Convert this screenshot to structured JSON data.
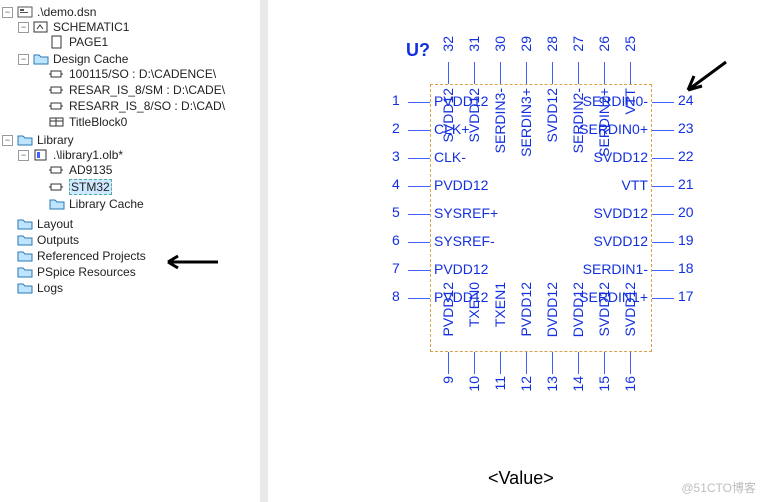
{
  "tree": {
    "root": ".\\demo.dsn",
    "schematic": "SCHEMATIC1",
    "page": "PAGE1",
    "cache": "Design Cache",
    "cache_items": [
      "100115/SO : D:\\CADENCE\\",
      "RESAR_IS_8/SM : D:\\CADE\\",
      "RESARR_IS_8/SO : D:\\CAD\\",
      "TitleBlock0"
    ],
    "library": "Library",
    "lib_file": ".\\library1.olb*",
    "parts": [
      "AD9135",
      "STM32"
    ],
    "lib_cache": "Library Cache",
    "folders": [
      "Layout",
      "Outputs",
      "Referenced Projects",
      "PSpice Resources",
      "Logs"
    ]
  },
  "schematic": {
    "refdes": "U?",
    "value": "<Value>",
    "left": [
      {
        "n": "1",
        "name": "PVDD12"
      },
      {
        "n": "2",
        "name": "CLK+"
      },
      {
        "n": "3",
        "name": "CLK-"
      },
      {
        "n": "4",
        "name": "PVDD12"
      },
      {
        "n": "5",
        "name": "SYSREF+"
      },
      {
        "n": "6",
        "name": "SYSREF-"
      },
      {
        "n": "7",
        "name": "PVDD12"
      },
      {
        "n": "8",
        "name": "PVDD12"
      }
    ],
    "right": [
      {
        "n": "24",
        "name": "SERDIN0-"
      },
      {
        "n": "23",
        "name": "SERDIN0+"
      },
      {
        "n": "22",
        "name": "SVDD12"
      },
      {
        "n": "21",
        "name": "VTT"
      },
      {
        "n": "20",
        "name": "SVDD12"
      },
      {
        "n": "19",
        "name": "SVDD12"
      },
      {
        "n": "18",
        "name": "SERDIN1-"
      },
      {
        "n": "17",
        "name": "SERDIN1+"
      }
    ],
    "top": [
      {
        "n": "32",
        "name": "SVDD12"
      },
      {
        "n": "31",
        "name": "SVDD12"
      },
      {
        "n": "30",
        "name": "SERDIN3-"
      },
      {
        "n": "29",
        "name": "SERDIN3+"
      },
      {
        "n": "28",
        "name": "SVDD12"
      },
      {
        "n": "27",
        "name": "SERDIN2-"
      },
      {
        "n": "26",
        "name": "SERDIN2+"
      },
      {
        "n": "25",
        "name": "VTT"
      }
    ],
    "bottom": [
      {
        "n": "9",
        "name": "PVDD12"
      },
      {
        "n": "10",
        "name": "TXEN0"
      },
      {
        "n": "11",
        "name": "TXEN1"
      },
      {
        "n": "12",
        "name": "PVDD12"
      },
      {
        "n": "13",
        "name": "DVDD12"
      },
      {
        "n": "14",
        "name": "DVDD12"
      },
      {
        "n": "15",
        "name": "SVDD12"
      },
      {
        "n": "16",
        "name": "SVDD12"
      }
    ]
  },
  "watermark": "@51CTO博客"
}
